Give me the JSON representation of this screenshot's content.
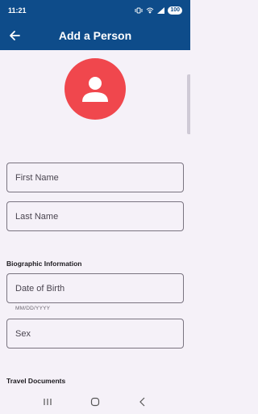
{
  "status_bar": {
    "time": "11:21",
    "battery": "100"
  },
  "app_bar": {
    "title": "Add a Person",
    "back_icon": "arrow-left-icon"
  },
  "avatar": {
    "icon": "person-icon",
    "color": "#f0474d"
  },
  "form": {
    "first_name_placeholder": "First Name",
    "last_name_placeholder": "Last Name",
    "biographic_section": "Biographic Information",
    "dob_placeholder": "Date of Birth",
    "dob_helper": "MM/DD/YYYY",
    "sex_placeholder": "Sex",
    "travel_section": "Travel Documents"
  },
  "colors": {
    "primary": "#0e4c8a",
    "background": "#f5f1f8"
  }
}
